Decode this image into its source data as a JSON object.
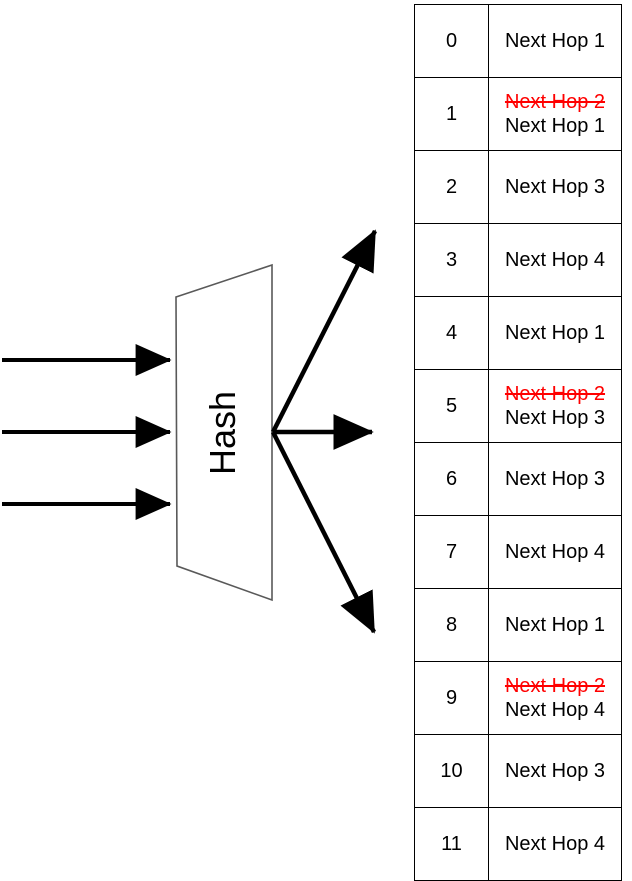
{
  "diagram": {
    "title_hidden": "",
    "hash_block": {
      "label": "Hash",
      "shape": "trapezoid",
      "fill": "#FFFFFF",
      "stroke": "#595959"
    },
    "input_arrows": [
      {
        "name": "input-flow-1",
        "label": ""
      },
      {
        "name": "input-flow-2",
        "label": ""
      },
      {
        "name": "input-flow-3",
        "label": ""
      }
    ],
    "output_arrows": [
      {
        "name": "output-flow-up",
        "label": ""
      },
      {
        "name": "output-flow-middle",
        "label": ""
      },
      {
        "name": "output-flow-down",
        "label": ""
      }
    ],
    "colors": {
      "arrow": "#000000",
      "block_outline": "#595959",
      "removed_entry": "#FF0000",
      "active_entry": "#000000",
      "table_border": "#000000"
    }
  },
  "table": {
    "name": "hash-bucket-table",
    "columns": [
      "",
      ""
    ],
    "rows": [
      {
        "index": "0",
        "old_value": "",
        "value": "Next Hop 1"
      },
      {
        "index": "1",
        "old_value": "Next Hop 2",
        "value": "Next Hop 1"
      },
      {
        "index": "2",
        "old_value": "",
        "value": "Next Hop 3"
      },
      {
        "index": "3",
        "old_value": "",
        "value": "Next Hop 4"
      },
      {
        "index": "4",
        "old_value": "",
        "value": "Next Hop 1"
      },
      {
        "index": "5",
        "old_value": "Next Hop 2",
        "value": "Next Hop 3"
      },
      {
        "index": "6",
        "old_value": "",
        "value": "Next Hop 3"
      },
      {
        "index": "7",
        "old_value": "",
        "value": "Next Hop 4"
      },
      {
        "index": "8",
        "old_value": "",
        "value": "Next Hop 1"
      },
      {
        "index": "9",
        "old_value": "Next Hop 2",
        "value": "Next Hop 4"
      },
      {
        "index": "10",
        "old_value": "",
        "value": "Next Hop 3"
      },
      {
        "index": "11",
        "old_value": "",
        "value": "Next Hop 4"
      }
    ]
  }
}
